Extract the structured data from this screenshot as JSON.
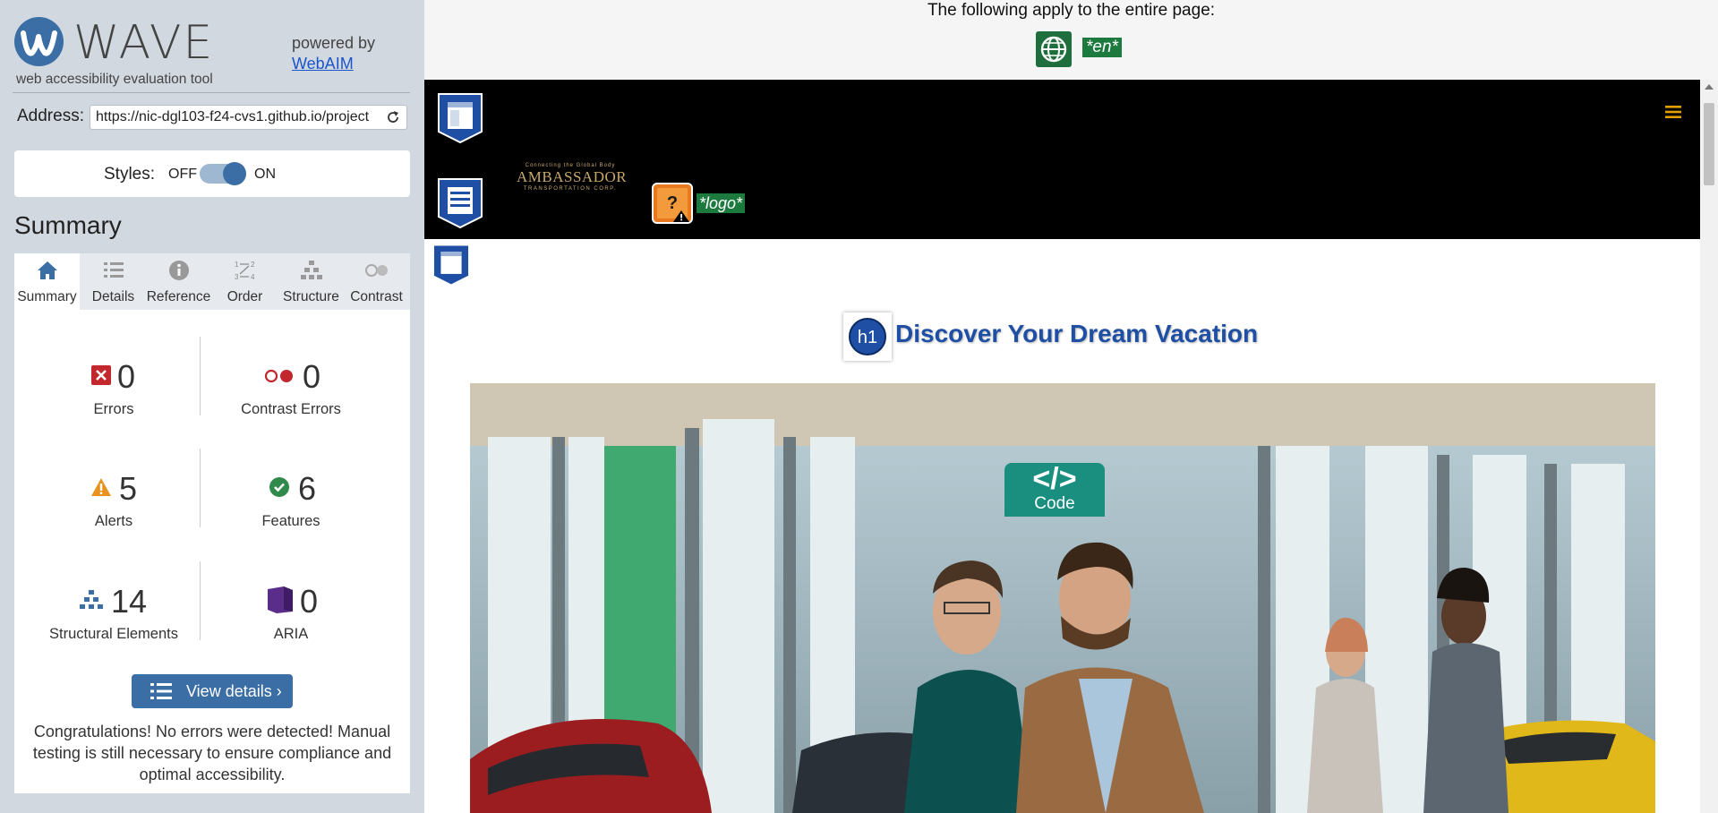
{
  "wave": {
    "brand": "WAVE",
    "tagline": "web accessibility evaluation tool",
    "powered_by": "powered by",
    "powered_link": "WebAIM"
  },
  "address": {
    "label": "Address:",
    "value": "https://nic-dgl103-f24-cvs1.github.io/project"
  },
  "styles": {
    "label": "Styles:",
    "off": "OFF",
    "on": "ON",
    "state": "on"
  },
  "summary_heading": "Summary",
  "tabs": [
    {
      "label": "Summary",
      "icon": "home-icon",
      "active": true
    },
    {
      "label": "Details",
      "icon": "list-icon"
    },
    {
      "label": "Reference",
      "icon": "info-icon"
    },
    {
      "label": "Order",
      "icon": "order-icon"
    },
    {
      "label": "Structure",
      "icon": "structure-icon"
    },
    {
      "label": "Contrast",
      "icon": "contrast-icon"
    }
  ],
  "stats": {
    "errors": {
      "value": "0",
      "label": "Errors"
    },
    "contrast_errors": {
      "value": "0",
      "label": "Contrast Errors"
    },
    "alerts": {
      "value": "5",
      "label": "Alerts"
    },
    "features": {
      "value": "6",
      "label": "Features"
    },
    "structural": {
      "value": "14",
      "label": "Structural Elements"
    },
    "aria": {
      "value": "0",
      "label": "ARIA"
    }
  },
  "view_details": "View details ›",
  "congrats": "Congratulations! No errors were detected! Manual testing is still necessary to ensure compliance and optimal accessibility.",
  "page": {
    "apply_note": "The following apply to the entire page:",
    "lang_badge": "*en*",
    "logo_badge": "*logo*",
    "ambassador_top": "Connecting the Global Body",
    "ambassador_main": "AMBASSADOR",
    "ambassador_sub": "TRANSPORTATION CORP.",
    "alert_glyph": "?",
    "h1_badge": "h1",
    "heading": "Discover Your Dream Vacation",
    "code_symbol": "</>",
    "code_label": "Code"
  },
  "colors": {
    "wave_blue": "#3a6ea5",
    "error_red": "#c2272d",
    "alert_orange": "#e8931f",
    "feature_green": "#2f8a4c",
    "aria_purple": "#5b2d8a",
    "badge_green": "#1d7a3e",
    "heading_blue": "#1e4fa5",
    "code_teal": "#1a8f80"
  }
}
